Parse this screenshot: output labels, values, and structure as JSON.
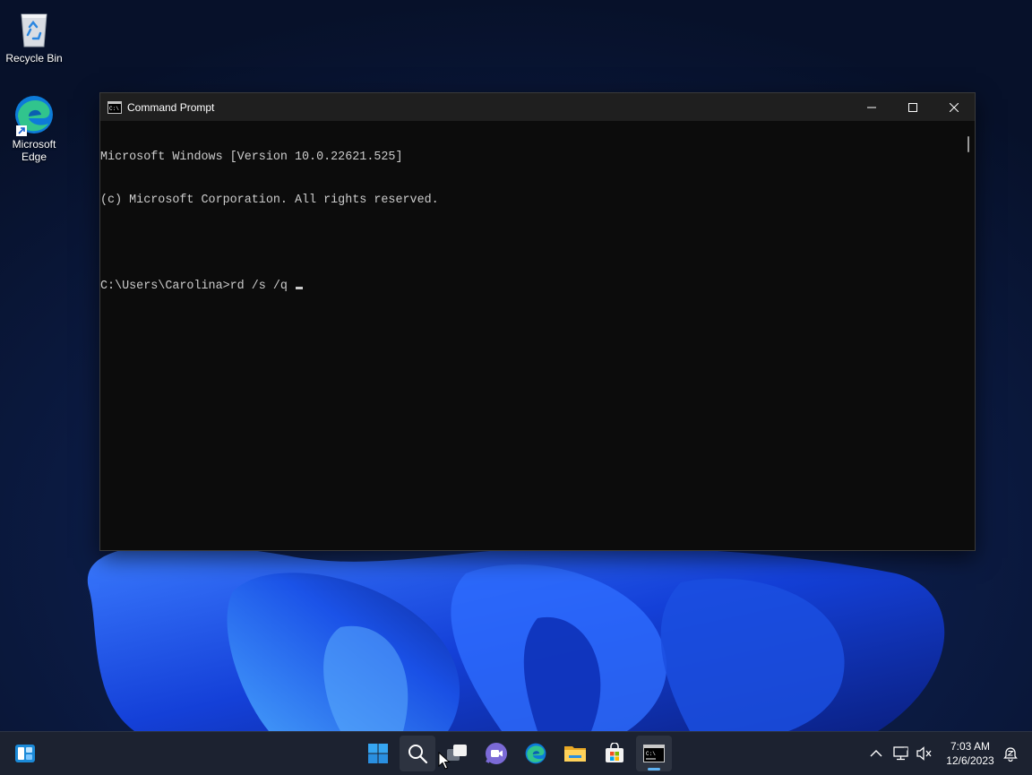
{
  "desktop": {
    "icons": [
      {
        "label": "Recycle Bin",
        "icon": "recycle-bin-icon"
      },
      {
        "label": "Microsoft Edge",
        "icon": "edge-icon"
      }
    ]
  },
  "window": {
    "title": "Command Prompt",
    "icon": "cmd-icon",
    "lines": [
      "Microsoft Windows [Version 10.0.22621.525]",
      "(c) Microsoft Corporation. All rights reserved.",
      "",
      "C:\\Users\\Carolina>rd /s /q "
    ],
    "controls": [
      "minimize-icon",
      "maximize-icon",
      "close-icon"
    ]
  },
  "taskbar": {
    "apps": [
      "widgets-icon",
      "start-icon",
      "search-icon",
      "task-view-icon",
      "teams-chat-icon",
      "edge-icon",
      "file-explorer-icon",
      "store-icon",
      "terminal-icon"
    ],
    "active_app": "terminal-icon",
    "tray_icons": [
      "chevron-up-icon",
      "network-icon",
      "volume-muted-icon",
      "notifications-icon"
    ],
    "time": "7:03 AM",
    "date": "12/6/2023"
  },
  "colors": {
    "accent": "#5fb2f2",
    "console_bg": "#0c0c0c",
    "console_text": "#cccccc"
  }
}
